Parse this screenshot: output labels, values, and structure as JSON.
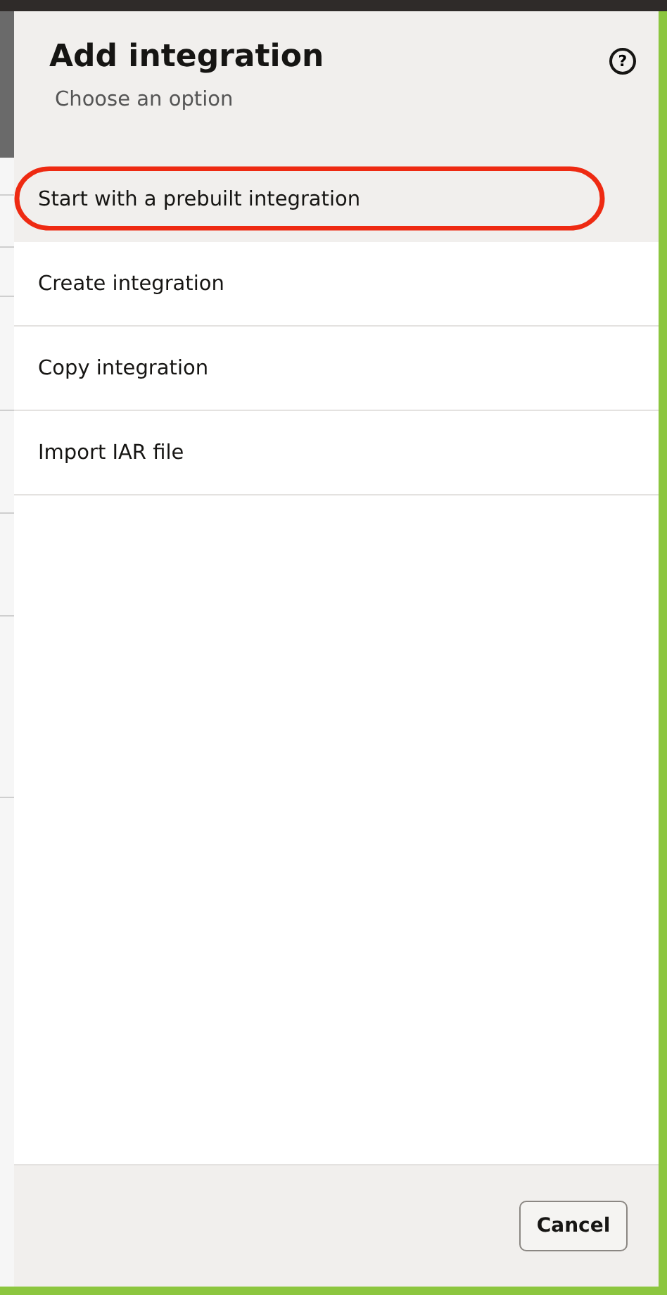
{
  "panel": {
    "title": "Add integration",
    "subtitle": "Choose an option",
    "help_icon": "?"
  },
  "options": [
    {
      "label": "Start with a prebuilt integration",
      "selected": true,
      "circled": true
    },
    {
      "label": "Create integration",
      "selected": false,
      "circled": false
    },
    {
      "label": "Copy integration",
      "selected": false,
      "circled": false
    },
    {
      "label": "Import IAR file",
      "selected": false,
      "circled": false
    }
  ],
  "footer": {
    "buttons": [
      "Cancel"
    ]
  }
}
